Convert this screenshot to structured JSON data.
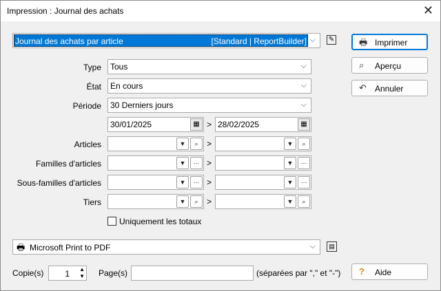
{
  "window": {
    "title": "Impression : Journal des achats"
  },
  "report": {
    "name": "Journal des achats par article",
    "tag": "[Standard | ReportBuilder]"
  },
  "buttons": {
    "print": "Imprimer",
    "preview": "Aperçu",
    "cancel": "Annuler",
    "help": "Aide"
  },
  "filters": {
    "type": {
      "label": "Type",
      "value": "Tous"
    },
    "etat": {
      "label": "État",
      "value": "En cours"
    },
    "periode": {
      "label": "Période",
      "value": "30 Derniers jours"
    },
    "date_from": "30/01/2025",
    "date_to": "28/02/2025",
    "range_sep": ">"
  },
  "ranges": {
    "articles": "Articles",
    "familles": "Familles d'articles",
    "sous_familles": "Sous-familles d'articles",
    "tiers": "Tiers"
  },
  "options": {
    "totaux_label": "Uniquement les totaux",
    "totaux_checked": false
  },
  "printer": {
    "name": "Microsoft Print to PDF"
  },
  "bottom": {
    "copies_label": "Copie(s)",
    "copies_value": "1",
    "pages_label": "Page(s)",
    "pages_value": "",
    "pages_hint": "(séparées par \",\" et \"-\")"
  }
}
